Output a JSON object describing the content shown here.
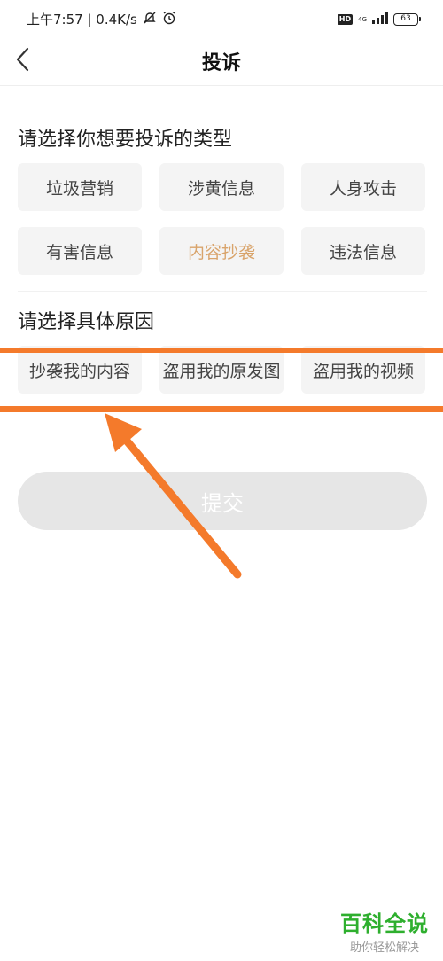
{
  "status_bar": {
    "left_text": "上午7:57 | 0.4K/s",
    "hd_label": "HD",
    "network_label": "4G",
    "battery_level": "63"
  },
  "header": {
    "title": "投诉"
  },
  "complaint_type": {
    "heading": "请选择你想要投诉的类型",
    "options": [
      "垃圾营销",
      "涉黄信息",
      "人身攻击",
      "有害信息",
      "内容抄袭",
      "违法信息"
    ],
    "selected": "内容抄袭",
    "selected_color": "#d9a46b"
  },
  "reason": {
    "heading": "请选择具体原因",
    "options": [
      "抄袭我的内容",
      "盗用我的原发图",
      "盗用我的视频"
    ]
  },
  "submit": {
    "label": "提交"
  },
  "annotation": {
    "color": "#f47a2b"
  },
  "watermark": {
    "title": "百科全说",
    "subtitle": "助你轻松解决"
  }
}
